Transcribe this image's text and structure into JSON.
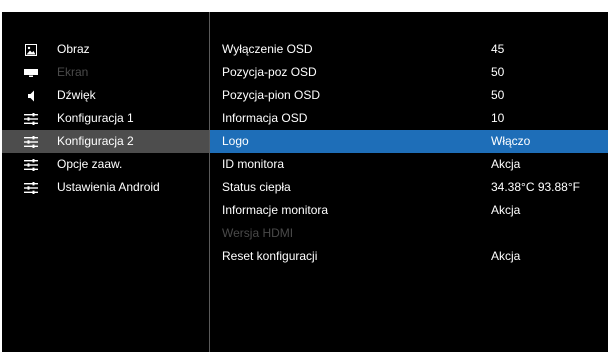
{
  "left_menu": {
    "items": [
      {
        "label": "Obraz",
        "icon": "image-icon",
        "state": "normal"
      },
      {
        "label": "Ekran",
        "icon": "screen-icon",
        "state": "disabled"
      },
      {
        "label": "Dźwięk",
        "icon": "speaker-icon",
        "state": "normal"
      },
      {
        "label": "Konfiguracja 1",
        "icon": "sliders-icon",
        "state": "normal"
      },
      {
        "label": "Konfiguracja 2",
        "icon": "sliders-icon",
        "state": "selected"
      },
      {
        "label": "Opcje zaaw.",
        "icon": "sliders-icon",
        "state": "normal"
      },
      {
        "label": "Ustawienia Android",
        "icon": "sliders-icon",
        "state": "normal"
      }
    ]
  },
  "settings": {
    "items": [
      {
        "label": "Wyłączenie OSD",
        "value": "45",
        "state": "normal"
      },
      {
        "label": "Pozycja-poz OSD",
        "value": "50",
        "state": "normal"
      },
      {
        "label": "Pozycja-pion OSD",
        "value": "50",
        "state": "normal"
      },
      {
        "label": "Informacja OSD",
        "value": "10",
        "state": "normal"
      },
      {
        "label": "Logo",
        "value": "Włączo",
        "state": "selected"
      },
      {
        "label": "ID monitora",
        "value": "Akcja",
        "state": "normal"
      },
      {
        "label": "Status ciepła",
        "value": "34.38°C 93.88°F",
        "state": "normal"
      },
      {
        "label": "Informacje monitora",
        "value": "Akcja",
        "state": "normal"
      },
      {
        "label": "Wersja HDMI",
        "value": "",
        "state": "disabled"
      },
      {
        "label": "Reset konfiguracji",
        "value": "Akcja",
        "state": "normal"
      }
    ]
  },
  "colors": {
    "background": "#000000",
    "text": "#ffffff",
    "disabled_text": "#4a4a4a",
    "left_selected": "#4d4d4d",
    "right_selected": "#1e6eb8",
    "divider": "#5a5a5a"
  }
}
